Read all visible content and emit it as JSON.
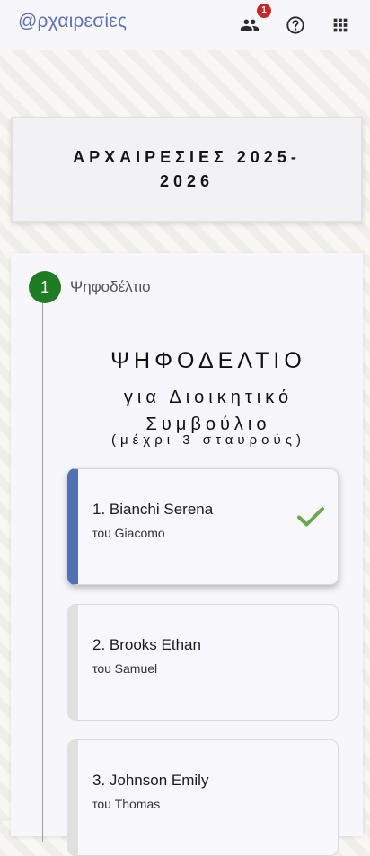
{
  "app": {
    "brand": "@ρχαιρεσίες",
    "notification_count": "1",
    "icons": [
      "people-icon",
      "help-icon",
      "apps-grid-icon"
    ]
  },
  "title_card": {
    "title": "ΑΡΧΑΙΡΕΣΙΕΣ 2025-2026"
  },
  "stepper": {
    "step_number": "1",
    "step_label": "Ψηφοδέλτιο"
  },
  "ballot": {
    "title": "ΨΗΦΟΔΕΛΤΙΟ",
    "subtitle_line1": "για Διοικητικό",
    "subtitle_line2": "Συμβούλιο",
    "note": "(μέχρι 3 σταυρούς)"
  },
  "candidates": [
    {
      "name": "1. Bianchi Serena",
      "father": "του Giacomo",
      "selected": true
    },
    {
      "name": "2. Brooks Ethan",
      "father": "του Samuel",
      "selected": false
    },
    {
      "name": "3. Johnson Emily",
      "father": "του Thomas",
      "selected": false
    }
  ],
  "colors": {
    "brand": "#5b73b5",
    "step_active": "#1e7d23",
    "selected_accent": "#5271b3",
    "check": "#6aa84f",
    "badge": "#c62828"
  }
}
